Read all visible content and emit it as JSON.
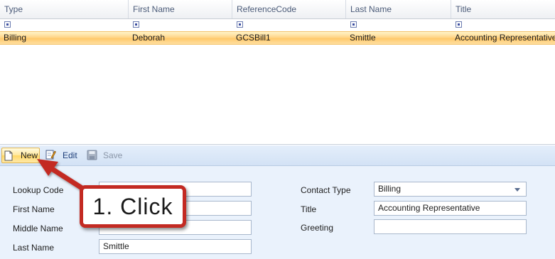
{
  "grid": {
    "columns": [
      {
        "label": "Type"
      },
      {
        "label": "First Name"
      },
      {
        "label": "ReferenceCode"
      },
      {
        "label": "Last Name"
      },
      {
        "label": "Title"
      }
    ],
    "rows": [
      {
        "type": "Billing",
        "first_name": "Deborah",
        "reference_code": "GCSBill1",
        "last_name": "Smittle",
        "title": "Accounting Representative"
      }
    ]
  },
  "toolbar": {
    "new_label": "New",
    "edit_label": "Edit",
    "save_label": "Save"
  },
  "form": {
    "lookup_code_label": "Lookup Code",
    "lookup_code_value": "",
    "first_name_label": "First Name",
    "first_name_value": "",
    "middle_name_label": "Middle Name",
    "middle_name_value": "",
    "last_name_label": "Last Name",
    "last_name_value": "Smittle",
    "contact_type_label": "Contact Type",
    "contact_type_value": "Billing",
    "title_label": "Title",
    "title_value": "Accounting Representative",
    "greeting_label": "Greeting",
    "greeting_value": ""
  },
  "callout": {
    "text": "1. Click",
    "color": "#c32a22"
  },
  "colors": {
    "selected_row": "#ffc96b",
    "toolbar_bg": "#d3e2f5",
    "form_bg": "#eaf2fc"
  }
}
